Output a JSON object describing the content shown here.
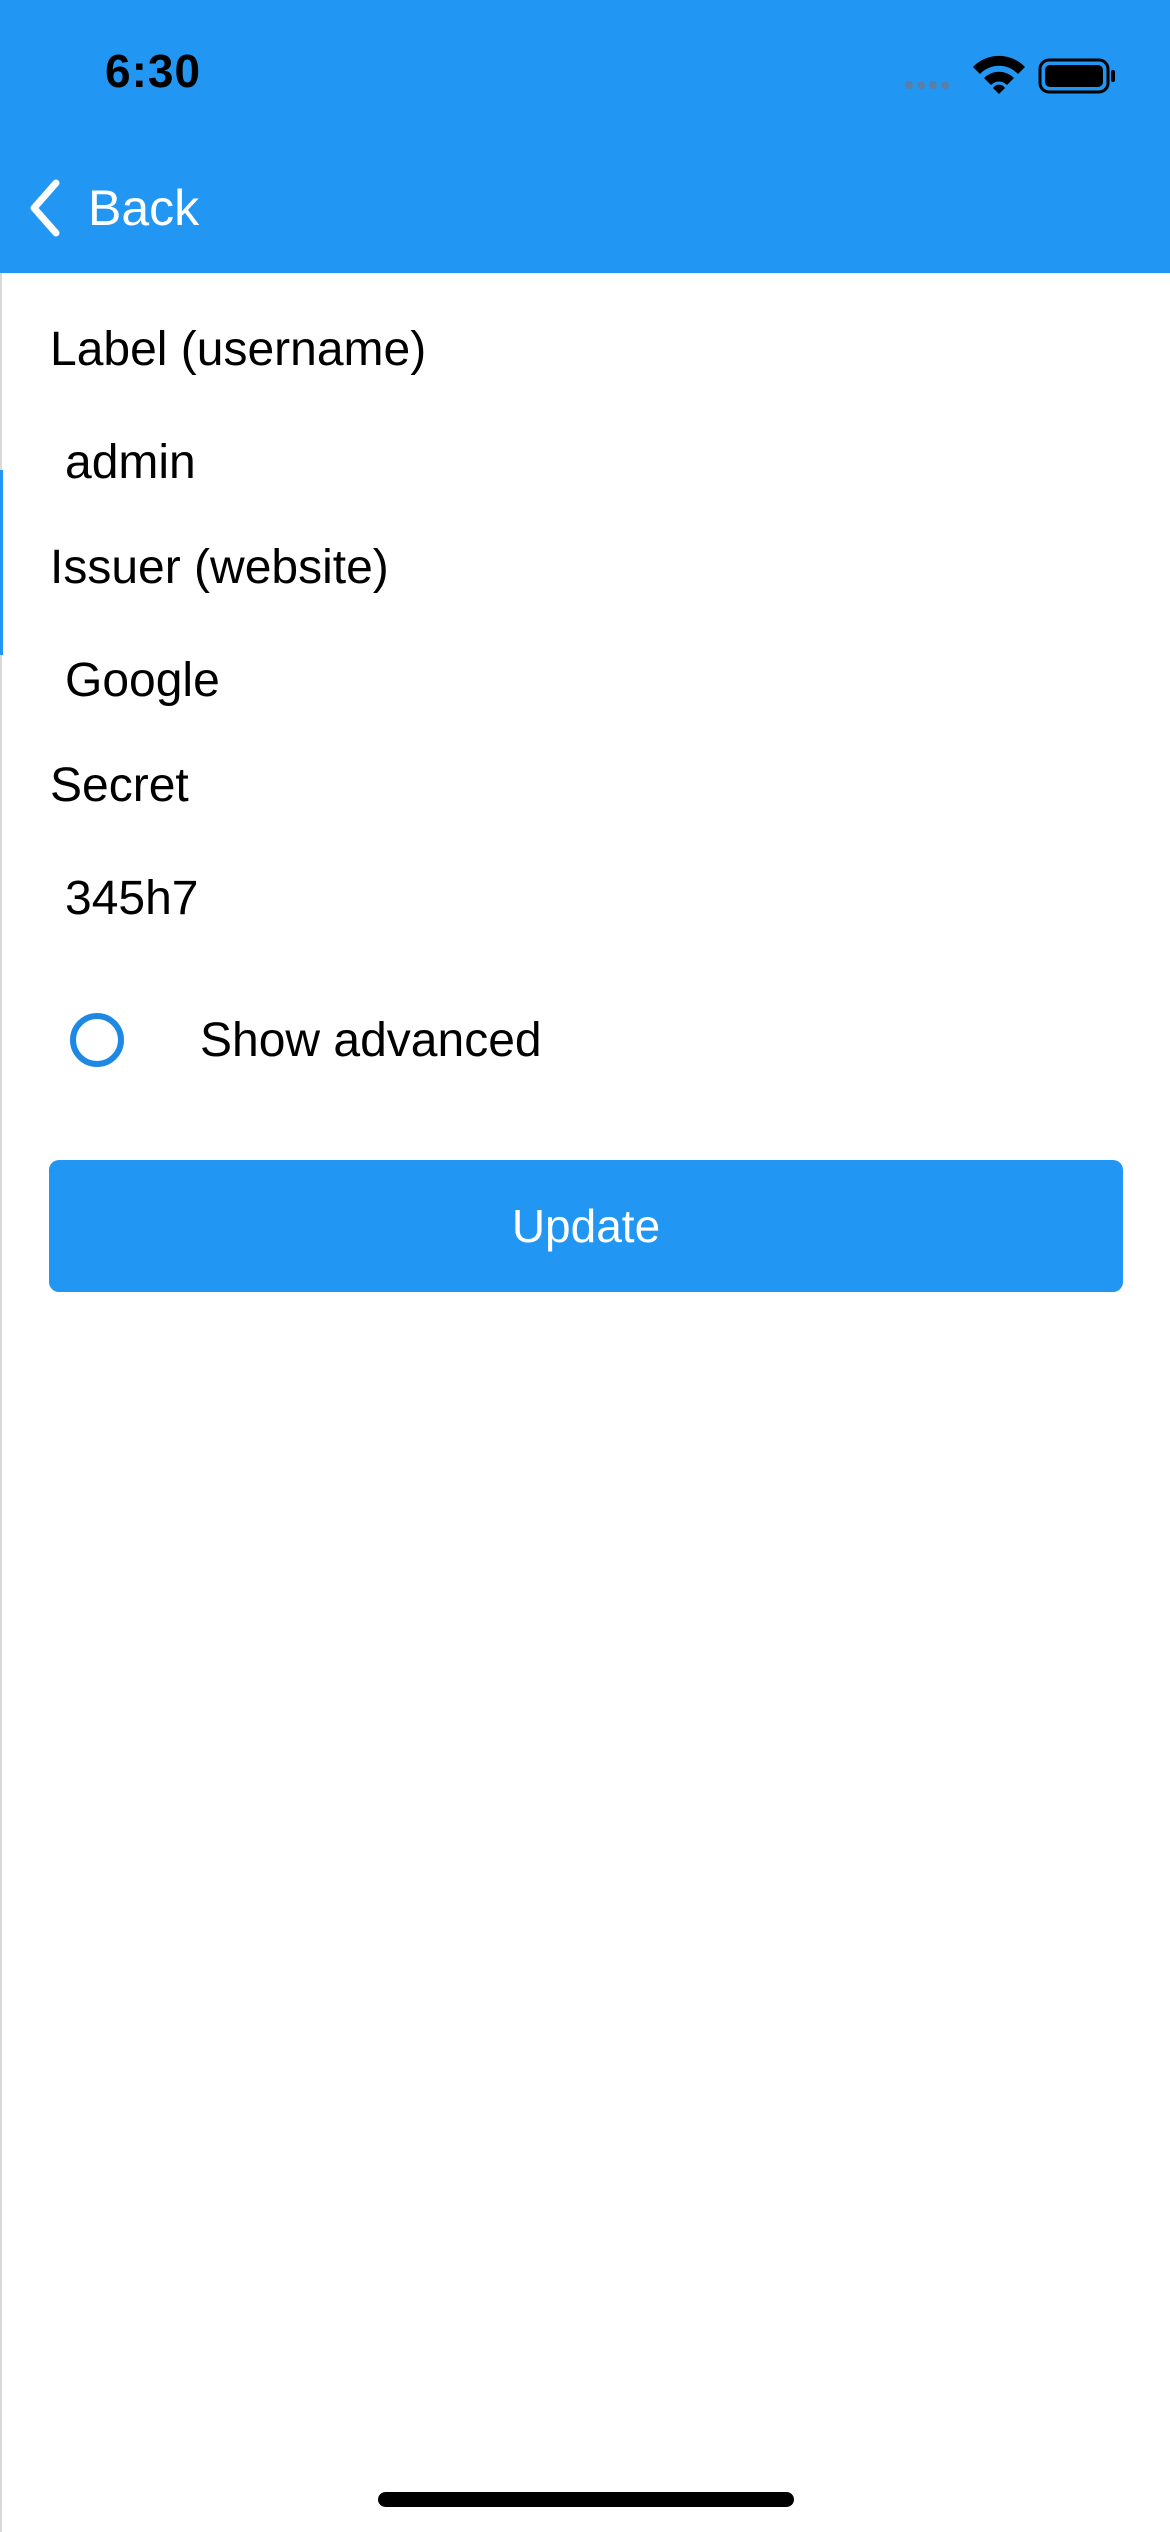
{
  "status_bar": {
    "time": "6:30",
    "icons": [
      "cellular-signal-icon",
      "wifi-icon",
      "battery-icon"
    ]
  },
  "nav": {
    "back_label": "Back",
    "back_icon": "chevron-left-icon"
  },
  "form": {
    "label_field": {
      "label": "Label (username)",
      "value": "admin"
    },
    "issuer_field": {
      "label": "Issuer (website)",
      "value": "Google"
    },
    "secret_field": {
      "label": "Secret",
      "value": "345h7"
    },
    "show_advanced": {
      "label": "Show advanced",
      "checked": false
    },
    "update_label": "Update"
  },
  "colors": {
    "accent": "#2196f3",
    "radio_border": "#1e88e5",
    "background": "#ffffff",
    "text": "#000000"
  }
}
